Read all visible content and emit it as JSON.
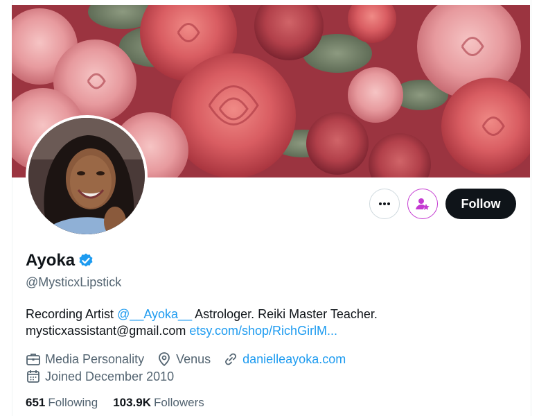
{
  "profile": {
    "name": "Ayoka",
    "handle": "@MysticxLipstick",
    "bio": {
      "text1": "Recording Artist ",
      "mention": "@__Ayoka__",
      "text2": " Astrologer. Reiki Master Teacher.",
      "email": "mysticxassistant@gmail.com",
      "shop_link": "etsy.com/shop/RichGirlM..."
    },
    "category": "Media Personality",
    "location": "Venus",
    "website": "danielleayoka.com",
    "joined": "Joined December 2010"
  },
  "stats": {
    "following_count": "651",
    "following_label": "Following",
    "followers_count": "103.9K",
    "followers_label": "Followers"
  },
  "actions": {
    "follow_label": "Follow"
  },
  "icons": {
    "more": "more-horizontal-icon",
    "subscribe": "user-star-icon",
    "verified": "verified-badge-icon",
    "category": "briefcase-icon",
    "location": "location-pin-icon",
    "website": "link-icon",
    "joined": "calendar-icon"
  },
  "colors": {
    "accent_link": "#1d9bf0",
    "verified": "#1d9bf0",
    "follow_bg": "#0f1419",
    "subscribe": "#c43ad1",
    "muted_text": "#536471"
  }
}
